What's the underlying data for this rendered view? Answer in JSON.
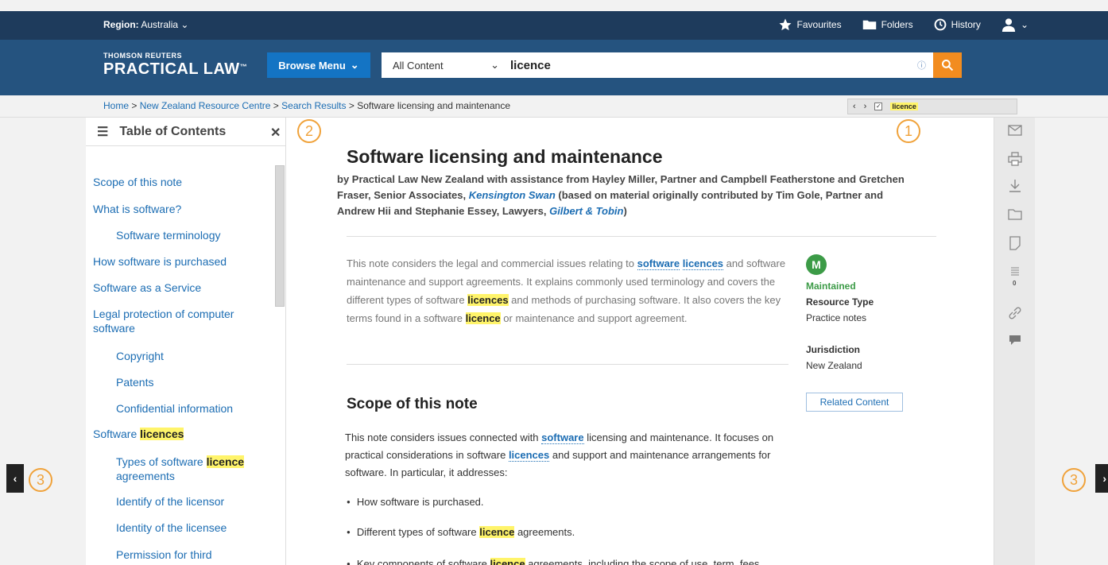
{
  "topbar": {
    "region_label": "Region:",
    "region_value": "Australia",
    "favourites": "Favourites",
    "folders": "Folders",
    "history": "History"
  },
  "logo": {
    "line1": "THOMSON REUTERS",
    "line2": "PRACTICAL LAW",
    "tm": "™"
  },
  "header": {
    "browse_menu": "Browse Menu",
    "search_scope": "All Content",
    "search_query": "licence",
    "info_glyph": "ⓘ"
  },
  "breadcrumb": {
    "items": [
      "Home",
      "New Zealand Resource Centre",
      "Search Results"
    ],
    "current": "Software licensing and maintenance",
    "sep": " > ",
    "term_filter": "licence"
  },
  "toc": {
    "title": "Table of Contents",
    "items": [
      {
        "text": "Scope of this note"
      },
      {
        "text": "What is software?"
      },
      {
        "text": "Software terminology"
      },
      {
        "text": "How software is purchased"
      },
      {
        "text": "Software as a Service"
      },
      {
        "text": "Legal protection of computer software"
      },
      {
        "text": "Copyright"
      },
      {
        "text": "Patents"
      },
      {
        "text": "Confidential information"
      },
      {
        "pre": "Software ",
        "hl": "licences"
      },
      {
        "pre": "Types of software ",
        "hl": "licence",
        "post": " agreements"
      },
      {
        "text": "Identify of the licensor"
      },
      {
        "text": "Identity of the licensee"
      },
      {
        "text": "Permission for third"
      }
    ]
  },
  "doc": {
    "title": "Software licensing and maintenance",
    "byline_pre": "by Practical Law New Zealand with assistance from Hayley Miller, Partner and Campbell Featherstone and Gretchen Fraser, Senior Associates, ",
    "firm1": "Kensington Swan",
    "byline_mid": " (based on material originally contributed by Tim Gole, Partner and Andrew Hii and Stephanie Essey, Lawyers, ",
    "firm2": "Gilbert & Tobin",
    "byline_end": ")",
    "abstract": {
      "p1": "This note considers the legal and commercial issues relating to ",
      "link1": "software",
      "sp": " ",
      "link2": "licences",
      "p2": " and software maintenance and support agreements. It explains commonly used terminology and covers the different types of software ",
      "hl1": "licences",
      "p3": " and methods of purchasing software. It also covers the key terms found in a software ",
      "hl2": "licence",
      "p4": " or maintenance and support agreement."
    },
    "side": {
      "badge": "M",
      "status": "Maintained",
      "resource_type_label": "Resource Type",
      "resource_type": "Practice notes",
      "jurisdiction_label": "Jurisdiction",
      "jurisdiction": "New Zealand",
      "related": "Related Content"
    },
    "scope_heading": "Scope of this note",
    "scope": {
      "p1": "This note considers issues connected with ",
      "link1": "software",
      "p2": " licensing and maintenance. It focuses on practical considerations in software ",
      "link2": "licences",
      "p3": " and support and maintenance arrangements for software. In particular, it addresses:"
    },
    "bullets": [
      {
        "text": "How software is purchased."
      },
      {
        "pre": "Different types of software ",
        "hl": "licence",
        "post": " agreements."
      },
      {
        "pre": "Key components of software ",
        "hl": "licence",
        "post": " agreements, including the scope of use, term, fees"
      }
    ]
  },
  "tools": {
    "count": "0"
  },
  "callouts": {
    "c1": "1",
    "c2": "2",
    "c3": "3"
  },
  "nav": {
    "prev": "‹",
    "next": "›"
  }
}
